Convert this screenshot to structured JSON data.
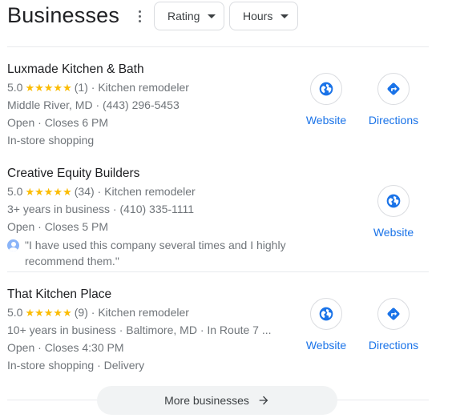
{
  "header": {
    "title": "Businesses",
    "filters": [
      {
        "label": "Rating"
      },
      {
        "label": "Hours"
      }
    ]
  },
  "listings": [
    {
      "name": "Luxmade Kitchen & Bath",
      "rating": "5.0",
      "stars": "★★★★★",
      "reviews": "(1)",
      "category": "Kitchen remodeler",
      "line2": "Middle River, MD · (443) 296-5453",
      "hours": "Open · Closes 6 PM",
      "line4": "In-store shopping",
      "actions": [
        "Website",
        "Directions"
      ]
    },
    {
      "name": "Creative Equity Builders",
      "rating": "5.0",
      "stars": "★★★★★",
      "reviews": "(34)",
      "category": "Kitchen remodeler",
      "line2": "3+ years in business · (410) 335-1111",
      "hours": "Open · Closes 5 PM",
      "review": "\"I have used this company several times and I highly recommend them.\"",
      "actions": [
        "Website"
      ]
    },
    {
      "name": "That Kitchen Place",
      "rating": "5.0",
      "stars": "★★★★★",
      "reviews": "(9)",
      "category": "Kitchen remodeler",
      "line2": "10+ years in business · Baltimore, MD · In Route 7 ...",
      "hours": "Open · Closes 4:30 PM",
      "line4": "In-store shopping · Delivery",
      "actions": [
        "Website",
        "Directions"
      ]
    }
  ],
  "more": {
    "label": "More businesses"
  },
  "icons": {
    "website": "globe-icon",
    "directions": "directions-icon",
    "more": "arrow-right-icon",
    "menu": "more-vert-icon",
    "caret": "caret-down-icon"
  },
  "colors": {
    "accent": "#1a73e8",
    "star": "#fbbc04",
    "secondary_text": "#70757a"
  }
}
